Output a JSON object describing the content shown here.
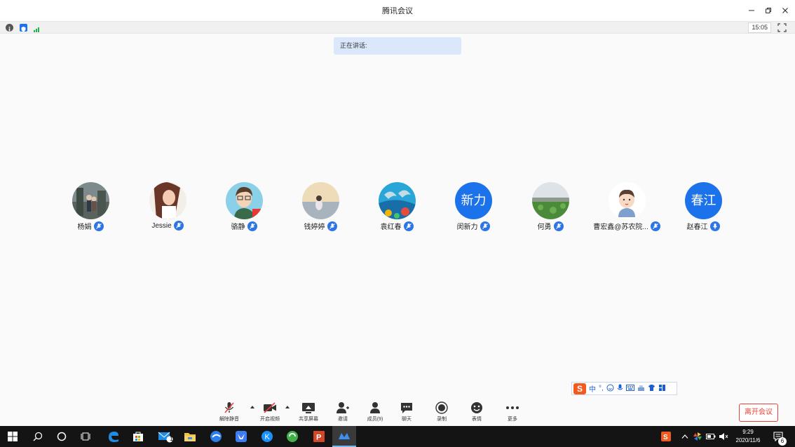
{
  "window": {
    "title": "腾讯会议"
  },
  "status": {
    "timer": "15:05"
  },
  "speaking_label": "正在讲话:",
  "participants": [
    {
      "name": "杨娟",
      "avatar": "photo",
      "mic": "muted"
    },
    {
      "name": "Jessie",
      "avatar": "photo",
      "mic": "muted"
    },
    {
      "name": "骆静",
      "avatar": "photo",
      "mic": "muted"
    },
    {
      "name": "钱婷婷",
      "avatar": "photo",
      "mic": "muted"
    },
    {
      "name": "袁红春",
      "avatar": "photo",
      "mic": "muted"
    },
    {
      "name": "闵新力",
      "avatar_text": "新力",
      "mic": "muted"
    },
    {
      "name": "何勇",
      "avatar": "photo",
      "mic": "muted"
    },
    {
      "name": "曹宏鑫@苏农院...",
      "avatar": "photo",
      "mic": "muted"
    },
    {
      "name": "赵春江",
      "avatar_text": "春江",
      "mic": "on"
    }
  ],
  "toolbar": {
    "unmute": "解除静音",
    "start_video": "开启视频",
    "share_screen": "共享屏幕",
    "invite": "邀请",
    "members": "成员(9)",
    "chat": "聊天",
    "record": "录制",
    "reactions": "表情",
    "more": "更多"
  },
  "leave_button": "离开会议",
  "ime": {
    "mode": "中",
    "punct": "°,"
  },
  "taskbar": {
    "time": "9:29",
    "date": "2020/11/6",
    "mail_badge": "1",
    "notification_count": "6"
  },
  "colors": {
    "accent": "#1b72ea",
    "leave": "#e9413a",
    "speaking_bg": "#dbe8fb"
  }
}
